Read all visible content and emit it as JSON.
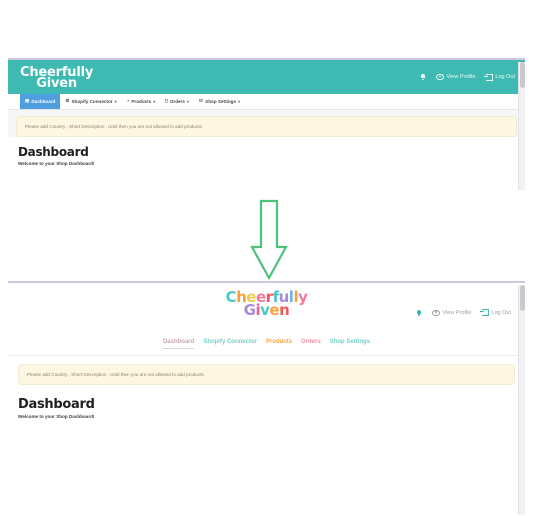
{
  "before": {
    "logo": {
      "line1": "Cheerfully",
      "line2": "Given"
    },
    "header_actions": [
      {
        "name": "notifications",
        "icon": "bell-icon",
        "label": ""
      },
      {
        "name": "view-profile",
        "icon": "eye-icon",
        "label": "View Profile"
      },
      {
        "name": "log-out",
        "icon": "logout-icon",
        "label": "Log Out"
      }
    ],
    "nav": [
      {
        "label": "Dashboard",
        "icon": "dashboard-icon",
        "active": true,
        "caret": false
      },
      {
        "label": "Shopify Connector",
        "icon": "gear-icon",
        "active": false,
        "caret": true
      },
      {
        "label": "Products",
        "icon": "tag-icon",
        "active": false,
        "caret": true
      },
      {
        "label": "Orders",
        "icon": "clipboard-icon",
        "active": false,
        "caret": true
      },
      {
        "label": "Shop Settings",
        "icon": "store-icon",
        "active": false,
        "caret": true
      }
    ],
    "alert": "Please add Country , Short Description . Until then you are not allowed to add products.",
    "page_title": "Dashboard",
    "page_subtitle": "Welcome to your Shop Dashboard!"
  },
  "arrow": {
    "name": "transition-arrow-down",
    "direction": "down",
    "color": "#4cc27a"
  },
  "after": {
    "logo_letters_line1": [
      {
        "ch": "C",
        "color": "#4cc8c0"
      },
      {
        "ch": "h",
        "color": "#f5a33c"
      },
      {
        "ch": "e",
        "color": "#f2c94c"
      },
      {
        "ch": "e",
        "color": "#f07aa0"
      },
      {
        "ch": "r",
        "color": "#ef5a5a"
      },
      {
        "ch": "f",
        "color": "#4cc8c0"
      },
      {
        "ch": "u",
        "color": "#a98cd6"
      },
      {
        "ch": "l",
        "color": "#6fb3e8"
      },
      {
        "ch": "l",
        "color": "#f5a33c"
      },
      {
        "ch": "y",
        "color": "#f07aa0"
      }
    ],
    "logo_letters_line2": [
      {
        "ch": "G",
        "color": "#a98cd6"
      },
      {
        "ch": "i",
        "color": "#ef5a9a"
      },
      {
        "ch": "v",
        "color": "#4cc8c0"
      },
      {
        "ch": "e",
        "color": "#f5a33c"
      },
      {
        "ch": "n",
        "color": "#ef5a5a"
      }
    ],
    "header_actions": [
      {
        "name": "notifications",
        "icon": "bell-icon",
        "label": ""
      },
      {
        "name": "view-profile",
        "icon": "eye-icon",
        "label": "View Profile"
      },
      {
        "name": "log-out",
        "icon": "logout-icon",
        "label": "Log Out"
      }
    ],
    "nav": [
      {
        "label": "Dashboard",
        "color": "#c9a6b5",
        "selected": true
      },
      {
        "label": "Shopify Connector",
        "color": "#76cfc9",
        "selected": false
      },
      {
        "label": "Products",
        "color": "#f5a33c",
        "selected": false
      },
      {
        "label": "Orders",
        "color": "#f58fa8",
        "selected": false
      },
      {
        "label": "Shop Settings",
        "color": "#76cfc9",
        "selected": false
      }
    ],
    "alert": "Please add Country , Short Description . Until then you are not allowed to add products.",
    "page_title": "Dashboard",
    "page_subtitle": "Welcome to your Shop Dashboard!"
  },
  "colors": {
    "teal_header": "#3ebab2",
    "active_nav": "#4f9fe0",
    "alert_bg": "#fdf6e3",
    "arrow_green": "#4cc27a",
    "panel_top_border": "#cfc7e2"
  }
}
